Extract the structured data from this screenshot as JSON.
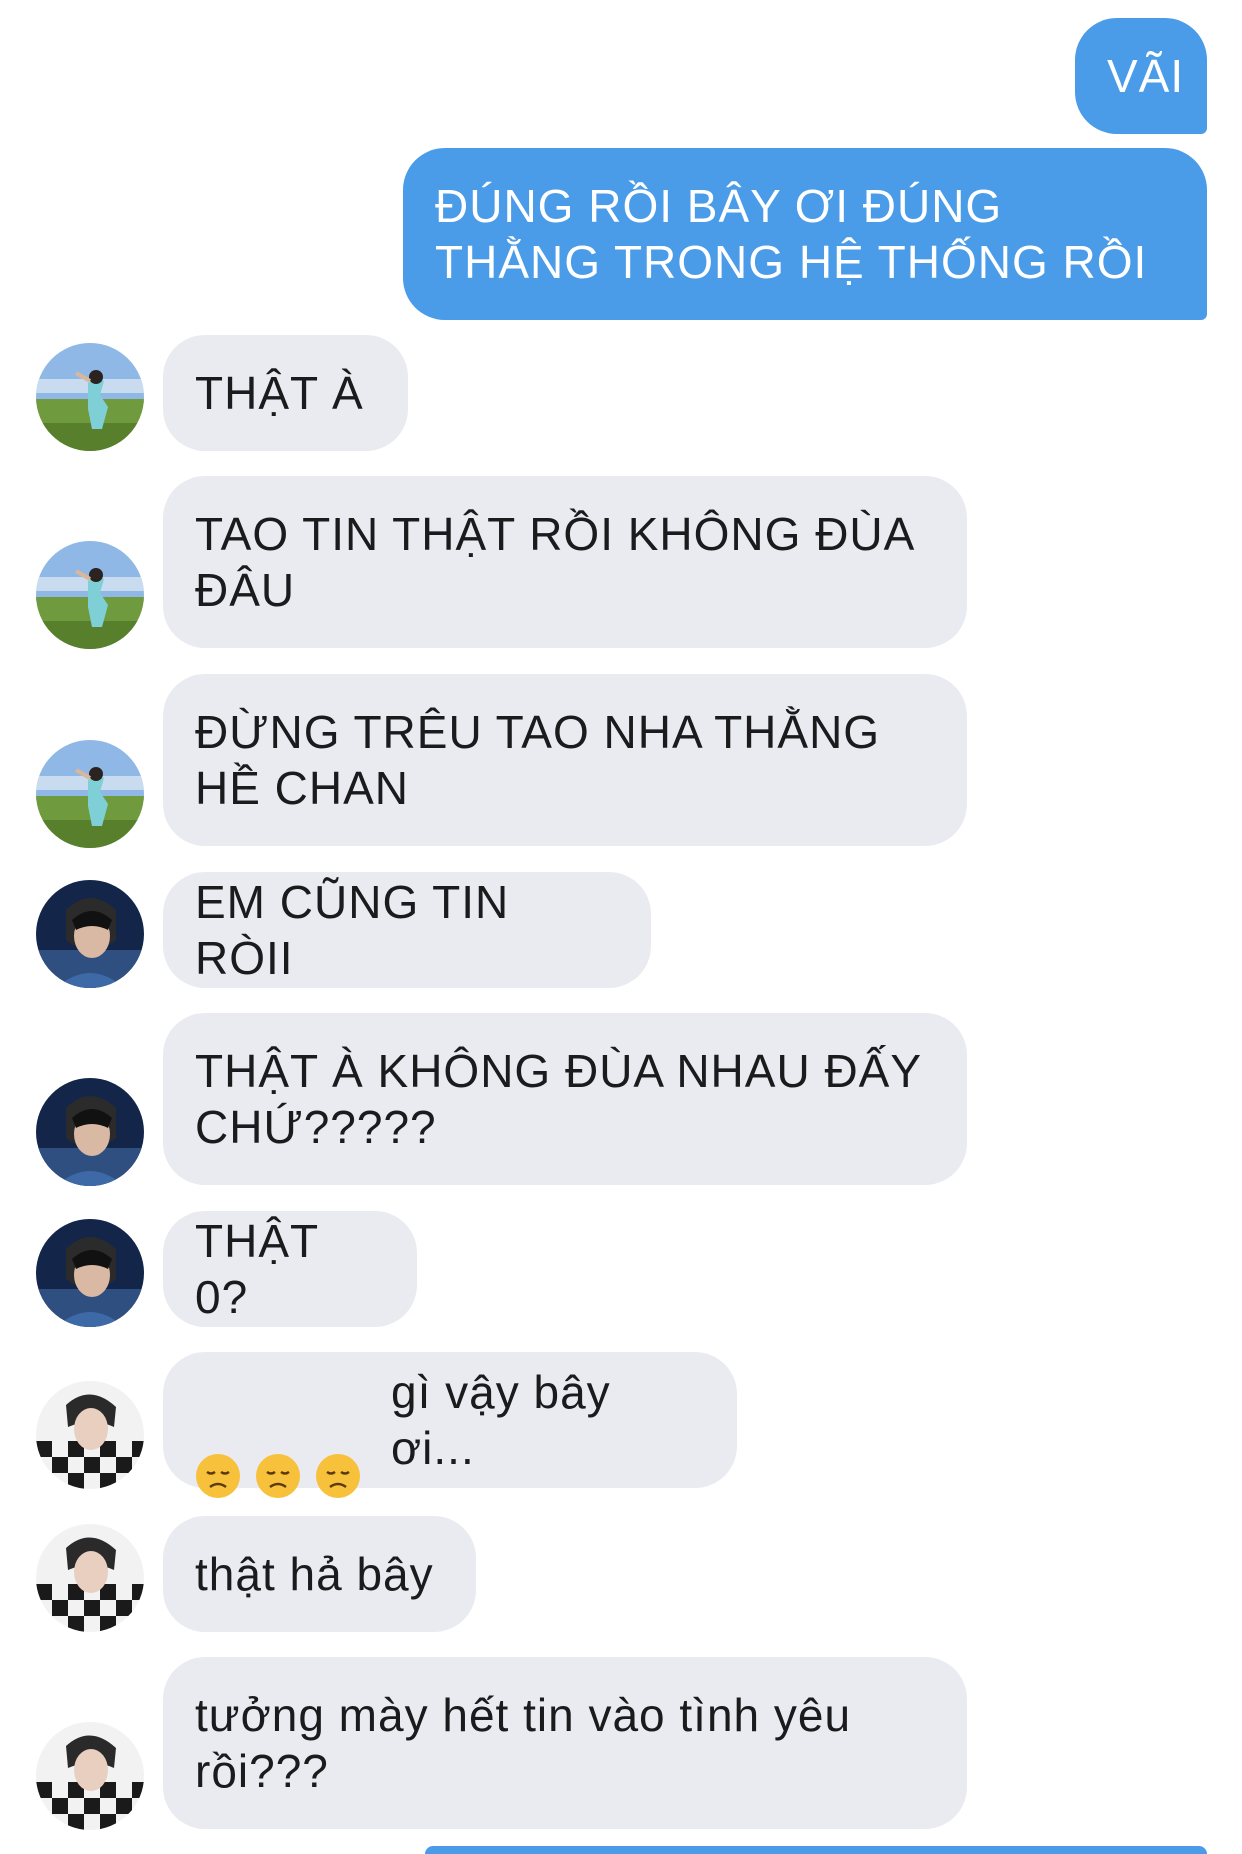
{
  "messages": [
    {
      "side": "out",
      "text": "VÃI"
    },
    {
      "side": "out",
      "text": "ĐÚNG RỒI BÂY ƠI ĐÚNG\nTHẰNG TRONG HỆ THỐNG RỒI"
    },
    {
      "side": "in",
      "sender": "user-a",
      "text": "THẬT À"
    },
    {
      "side": "in",
      "sender": "user-a",
      "text": "TAO TIN THẬT RỒI KHÔNG ĐÙA\nĐÂU"
    },
    {
      "side": "in",
      "sender": "user-a",
      "text": "ĐỪNG TRÊU TAO NHA THẰNG\nHỀ CHAN"
    },
    {
      "side": "in",
      "sender": "user-b",
      "text": "EM CŨNG TIN RÒII"
    },
    {
      "side": "in",
      "sender": "user-b",
      "text": "THẬT À KHÔNG ĐÙA NHAU ĐẤY\nCHỨ?????"
    },
    {
      "side": "in",
      "sender": "user-b",
      "text": "THẬT 0?"
    },
    {
      "side": "in",
      "sender": "user-c",
      "emoji": [
        "disappointed-face",
        "disappointed-face",
        "disappointed-face"
      ],
      "text": "gì vậy bây ơi..."
    },
    {
      "side": "in",
      "sender": "user-c",
      "text": "thật hả bây"
    },
    {
      "side": "in",
      "sender": "user-c",
      "text": "tưởng mày hết tin vào tình yêu\nrồi???"
    }
  ],
  "colors": {
    "outgoing_bubble": "#4a9be8",
    "incoming_bubble": "#e9ebf0",
    "incoming_text": "#1b1b1d",
    "outgoing_text": "#ffffff"
  }
}
